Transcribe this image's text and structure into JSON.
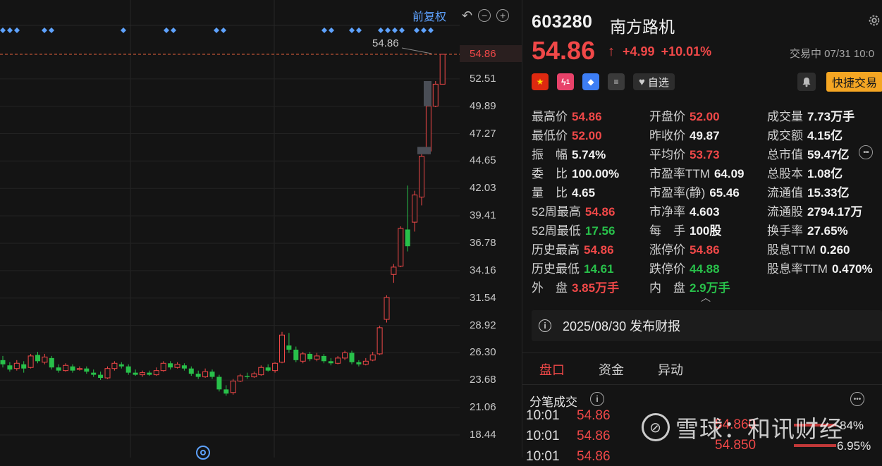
{
  "chart": {
    "adjust_label": "前复权",
    "price_line_label": "54.86",
    "current_price_axis": "54.86",
    "axis_ticks": [
      "52.51",
      "49.89",
      "47.27",
      "44.65",
      "42.03",
      "39.41",
      "36.78",
      "34.16",
      "31.54",
      "28.92",
      "26.30",
      "23.68",
      "21.06",
      "18.44"
    ],
    "icons": [
      "undo-icon",
      "zoom-out-icon",
      "zoom-in-icon",
      "location-icon"
    ]
  },
  "chart_data": {
    "type": "candlestick",
    "y_ticks": [
      52.51,
      49.89,
      47.27,
      44.65,
      42.03,
      39.41,
      36.78,
      34.16,
      31.54,
      28.92,
      26.3,
      23.68,
      21.06,
      18.44
    ],
    "ylim": [
      17.0,
      58.0
    ],
    "reference_line": 54.86,
    "grid": true,
    "candles": [
      {
        "o": 25.6,
        "c": 25.2,
        "h": 26.0,
        "l": 24.9
      },
      {
        "o": 25.1,
        "c": 24.7,
        "h": 25.4,
        "l": 24.5
      },
      {
        "o": 24.8,
        "c": 25.3,
        "h": 25.6,
        "l": 24.6
      },
      {
        "o": 25.2,
        "c": 24.8,
        "h": 25.5,
        "l": 24.4
      },
      {
        "o": 24.9,
        "c": 26.0,
        "h": 26.2,
        "l": 24.8
      },
      {
        "o": 26.1,
        "c": 25.5,
        "h": 26.4,
        "l": 25.3
      },
      {
        "o": 25.4,
        "c": 25.9,
        "h": 26.2,
        "l": 25.2
      },
      {
        "o": 25.8,
        "c": 24.9,
        "h": 26.0,
        "l": 24.7
      },
      {
        "o": 24.9,
        "c": 24.6,
        "h": 25.2,
        "l": 24.4
      },
      {
        "o": 24.6,
        "c": 25.1,
        "h": 25.3,
        "l": 24.5
      },
      {
        "o": 25.0,
        "c": 24.6,
        "h": 25.2,
        "l": 24.4
      },
      {
        "o": 24.7,
        "c": 24.8,
        "h": 25.0,
        "l": 24.6
      },
      {
        "o": 24.8,
        "c": 24.5,
        "h": 25.0,
        "l": 24.3
      },
      {
        "o": 24.4,
        "c": 24.2,
        "h": 24.7,
        "l": 24.0
      },
      {
        "o": 24.2,
        "c": 23.9,
        "h": 24.5,
        "l": 23.7
      },
      {
        "o": 23.9,
        "c": 24.8,
        "h": 25.0,
        "l": 23.8
      },
      {
        "o": 24.8,
        "c": 25.3,
        "h": 25.5,
        "l": 24.6
      },
      {
        "o": 25.2,
        "c": 25.0,
        "h": 25.4,
        "l": 24.8
      },
      {
        "o": 25.0,
        "c": 24.4,
        "h": 25.2,
        "l": 24.2
      },
      {
        "o": 24.4,
        "c": 24.2,
        "h": 24.7,
        "l": 24.1
      },
      {
        "o": 24.2,
        "c": 24.4,
        "h": 24.6,
        "l": 24.0
      },
      {
        "o": 24.4,
        "c": 24.2,
        "h": 24.6,
        "l": 24.1
      },
      {
        "o": 24.2,
        "c": 24.6,
        "h": 24.9,
        "l": 24.1
      },
      {
        "o": 24.6,
        "c": 25.3,
        "h": 25.5,
        "l": 24.5
      },
      {
        "o": 25.3,
        "c": 24.9,
        "h": 25.5,
        "l": 24.7
      },
      {
        "o": 24.9,
        "c": 25.2,
        "h": 25.4,
        "l": 24.8
      },
      {
        "o": 25.1,
        "c": 24.8,
        "h": 25.3,
        "l": 24.6
      },
      {
        "o": 24.8,
        "c": 24.3,
        "h": 25.0,
        "l": 24.1
      },
      {
        "o": 24.3,
        "c": 24.0,
        "h": 24.6,
        "l": 23.8
      },
      {
        "o": 24.0,
        "c": 24.5,
        "h": 24.8,
        "l": 23.9
      },
      {
        "o": 24.5,
        "c": 24.0,
        "h": 24.7,
        "l": 23.8
      },
      {
        "o": 24.0,
        "c": 22.8,
        "h": 24.2,
        "l": 22.6
      },
      {
        "o": 22.8,
        "c": 22.4,
        "h": 23.2,
        "l": 22.2
      },
      {
        "o": 22.5,
        "c": 23.6,
        "h": 23.8,
        "l": 22.3
      },
      {
        "o": 23.6,
        "c": 24.1,
        "h": 24.3,
        "l": 23.5
      },
      {
        "o": 24.1,
        "c": 24.0,
        "h": 24.4,
        "l": 23.8
      },
      {
        "o": 24.0,
        "c": 24.3,
        "h": 24.5,
        "l": 23.9
      },
      {
        "o": 24.2,
        "c": 24.9,
        "h": 25.1,
        "l": 24.1
      },
      {
        "o": 24.9,
        "c": 24.6,
        "h": 25.2,
        "l": 24.5
      },
      {
        "o": 24.6,
        "c": 25.3,
        "h": 25.4,
        "l": 24.4
      },
      {
        "o": 25.4,
        "c": 28.0,
        "h": 28.3,
        "l": 25.3
      },
      {
        "o": 27.0,
        "c": 26.6,
        "h": 28.2,
        "l": 26.3
      },
      {
        "o": 26.6,
        "c": 25.6,
        "h": 26.9,
        "l": 25.4
      },
      {
        "o": 25.5,
        "c": 26.2,
        "h": 26.4,
        "l": 25.3
      },
      {
        "o": 26.2,
        "c": 25.7,
        "h": 26.4,
        "l": 25.5
      },
      {
        "o": 25.7,
        "c": 26.0,
        "h": 26.3,
        "l": 25.5
      },
      {
        "o": 26.0,
        "c": 25.5,
        "h": 26.2,
        "l": 25.3
      },
      {
        "o": 25.5,
        "c": 25.3,
        "h": 25.8,
        "l": 25.1
      },
      {
        "o": 25.3,
        "c": 25.8,
        "h": 26.0,
        "l": 25.2
      },
      {
        "o": 25.8,
        "c": 26.3,
        "h": 26.5,
        "l": 25.6
      },
      {
        "o": 26.3,
        "c": 25.4,
        "h": 26.5,
        "l": 25.2
      },
      {
        "o": 25.4,
        "c": 25.2,
        "h": 25.6,
        "l": 25.0
      },
      {
        "o": 25.2,
        "c": 25.5,
        "h": 25.8,
        "l": 25.1
      },
      {
        "o": 25.6,
        "c": 26.1,
        "h": 26.4,
        "l": 25.5
      },
      {
        "o": 26.2,
        "c": 28.7,
        "h": 28.9,
        "l": 26.1
      },
      {
        "o": 29.5,
        "c": 31.6,
        "h": 31.8,
        "l": 29.2
      },
      {
        "o": 33.8,
        "c": 34.5,
        "h": 34.8,
        "l": 33.0
      },
      {
        "o": 34.6,
        "c": 38.2,
        "h": 38.4,
        "l": 34.5
      },
      {
        "o": 38.1,
        "c": 36.5,
        "h": 42.3,
        "l": 36.0
      },
      {
        "o": 38.8,
        "c": 41.4,
        "h": 41.8,
        "l": 37.9
      },
      {
        "o": 41.2,
        "c": 45.1,
        "h": 45.4,
        "l": 40.4
      },
      {
        "o": 45.6,
        "c": 49.9,
        "h": 50.0,
        "l": 45.3
      },
      {
        "o": 49.9,
        "c": 52.0,
        "h": 52.3,
        "l": 49.8
      },
      {
        "o": 52.0,
        "c": 54.86,
        "h": 54.86,
        "l": 52.0
      }
    ],
    "markers_row": true
  },
  "quote": {
    "code": "603280",
    "name": "南方路机",
    "price": "54.86",
    "arrow": "↑",
    "change": "+4.99",
    "change_pct": "+10.01%",
    "status": "交易中 07/31 10:0",
    "watch_label": "自选",
    "quick_trade_label": "快捷交易",
    "level_badge": "1",
    "stats_col1": [
      {
        "label": "最高价",
        "value": "54.86",
        "color": "red"
      },
      {
        "label": "最低价",
        "value": "52.00",
        "color": "red"
      },
      {
        "label": "振　幅",
        "value": "5.74%",
        "color": "white"
      },
      {
        "label": "委　比",
        "value": "100.00%",
        "color": "white"
      },
      {
        "label": "量　比",
        "value": "4.65",
        "color": "white"
      },
      {
        "label": "52周最高",
        "value": "54.86",
        "color": "red"
      },
      {
        "label": "52周最低",
        "value": "17.56",
        "color": "green"
      },
      {
        "label": "历史最高",
        "value": "54.86",
        "color": "red"
      },
      {
        "label": "历史最低",
        "value": "14.61",
        "color": "green"
      },
      {
        "label": "外　盘",
        "value": "3.85万手",
        "color": "red"
      }
    ],
    "stats_col2": [
      {
        "label": "开盘价",
        "value": "52.00",
        "color": "red"
      },
      {
        "label": "昨收价",
        "value": "49.87",
        "color": "white"
      },
      {
        "label": "平均价",
        "value": "53.73",
        "color": "red"
      },
      {
        "label": "市盈率TTM",
        "value": "64.09",
        "color": "white"
      },
      {
        "label": "市盈率(静)",
        "value": "65.46",
        "color": "white"
      },
      {
        "label": "市净率",
        "value": "4.603",
        "color": "white"
      },
      {
        "label": "每　手",
        "value": "100股",
        "color": "white"
      },
      {
        "label": "涨停价",
        "value": "54.86",
        "color": "red"
      },
      {
        "label": "跌停价",
        "value": "44.88",
        "color": "green"
      },
      {
        "label": "内　盘",
        "value": "2.9万手",
        "color": "green"
      }
    ],
    "stats_col3": [
      {
        "label": "成交量",
        "value": "7.73万手",
        "color": "white"
      },
      {
        "label": "成交额",
        "value": "4.15亿",
        "color": "white"
      },
      {
        "label": "总市值",
        "value": "59.47亿",
        "color": "white"
      },
      {
        "label": "总股本",
        "value": "1.08亿",
        "color": "white"
      },
      {
        "label": "流通值",
        "value": "15.33亿",
        "color": "white"
      },
      {
        "label": "流通股",
        "value": "2794.17万",
        "color": "white"
      },
      {
        "label": "换手率",
        "value": "27.65%",
        "color": "white"
      },
      {
        "label": "股息TTM",
        "value": "0.260",
        "color": "white"
      },
      {
        "label": "股息率TTM",
        "value": "0.470%",
        "color": "white"
      }
    ],
    "notice": "2025/08/30  发布财报",
    "tabs": [
      "盘口",
      "资金",
      "异动"
    ],
    "ticks_title": "分笔成交",
    "ticks": [
      {
        "time": "10:01",
        "price": "54.86"
      },
      {
        "time": "10:01",
        "price": "54.86"
      },
      {
        "time": "10:01",
        "price": "54.86"
      }
    ],
    "depth": [
      {
        "price": "54.860",
        "pct": "84%"
      },
      {
        "price": "54.850",
        "pct": "6.95%"
      }
    ],
    "watermark": "雪球：和讯财经"
  },
  "colors": {
    "up": "#f04848",
    "down": "#28c04a",
    "accent": "#5ea2ff",
    "quick_trade": "#f5a623",
    "background": "#141414"
  }
}
